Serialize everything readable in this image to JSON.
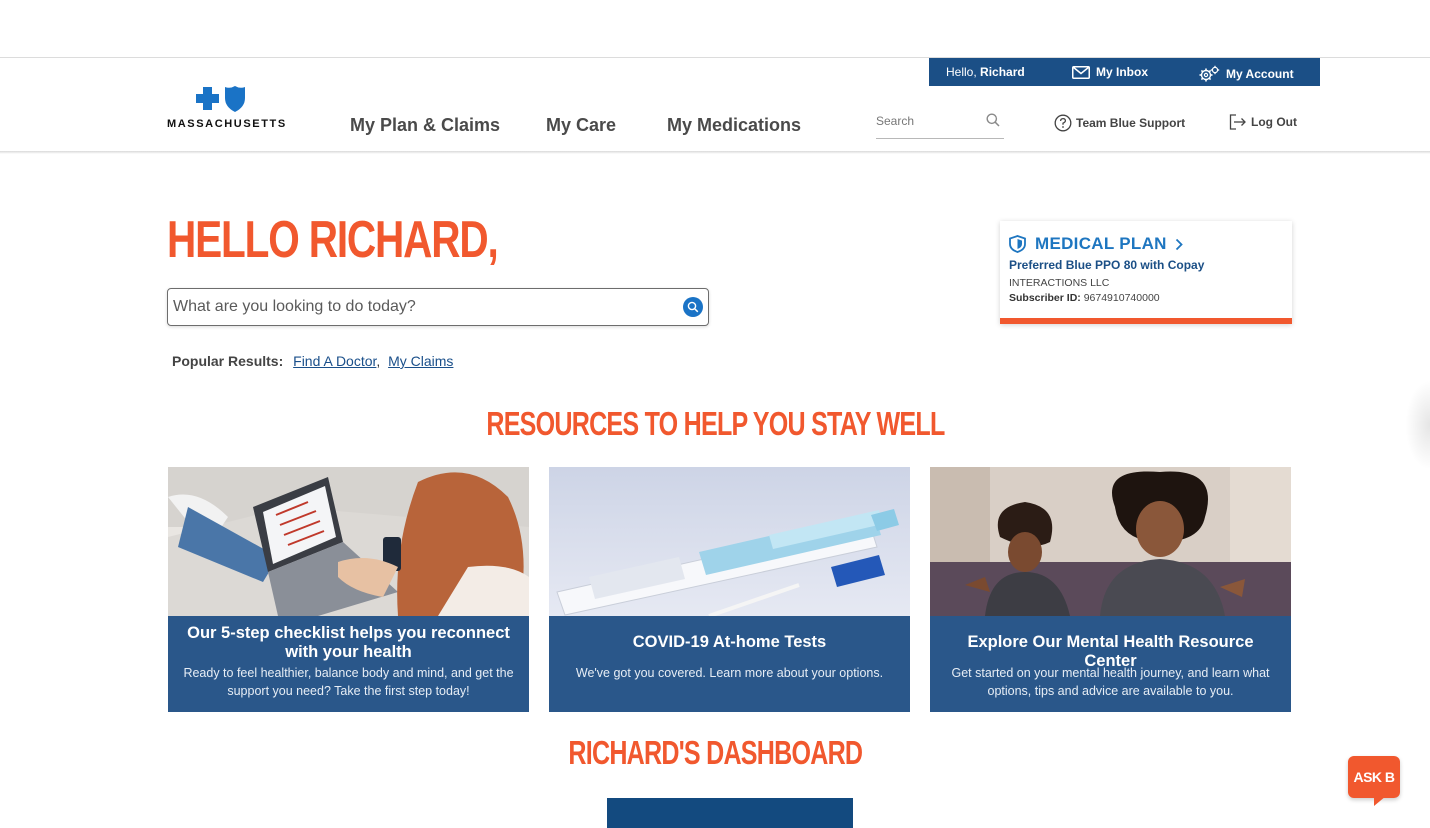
{
  "utility_bar": {
    "hello_prefix": "Hello,",
    "user_name": "Richard",
    "inbox_label": "My Inbox",
    "account_label": "My Account"
  },
  "brand": {
    "logo_text": "MASSACHUSETTS",
    "color_blue": "#1a73c6",
    "color_navy": "#1b4f86",
    "color_orange": "#f1582e"
  },
  "nav": {
    "items": [
      "My Plan & Claims",
      "My Care",
      "My Medications"
    ],
    "search_placeholder": "Search",
    "support_label": "Team Blue Support",
    "logout_label": "Log Out"
  },
  "hero": {
    "greeting": "HELLO RICHARD,",
    "search_placeholder": "What are you looking to do today?",
    "popular_label": "Popular Results:",
    "popular_links": [
      "Find A Doctor",
      "My Claims"
    ]
  },
  "plan_card": {
    "title": "MEDICAL PLAN",
    "plan_name": "Preferred Blue PPO 80 with Copay",
    "organization": "INTERACTIONS LLC",
    "subscriber_label": "Subscriber ID:",
    "subscriber_id": "9674910740000"
  },
  "resources": {
    "heading": "RESOURCES TO HELP YOU STAY WELL",
    "cards": [
      {
        "title": "Our 5-step checklist helps you reconnect with your health",
        "description": "Ready to feel healthier, balance body and mind, and get the support you need? Take the first step today!"
      },
      {
        "title": "COVID-19 At-home Tests",
        "description": "We've got you covered. Learn more about your options."
      },
      {
        "title": "Explore Our Mental Health Resource Center",
        "description": "Get started on your mental health journey, and learn what options, tips and advice are available to you."
      }
    ]
  },
  "dashboard": {
    "heading": "RICHARD'S DASHBOARD"
  },
  "chat": {
    "label": "ASK B"
  }
}
